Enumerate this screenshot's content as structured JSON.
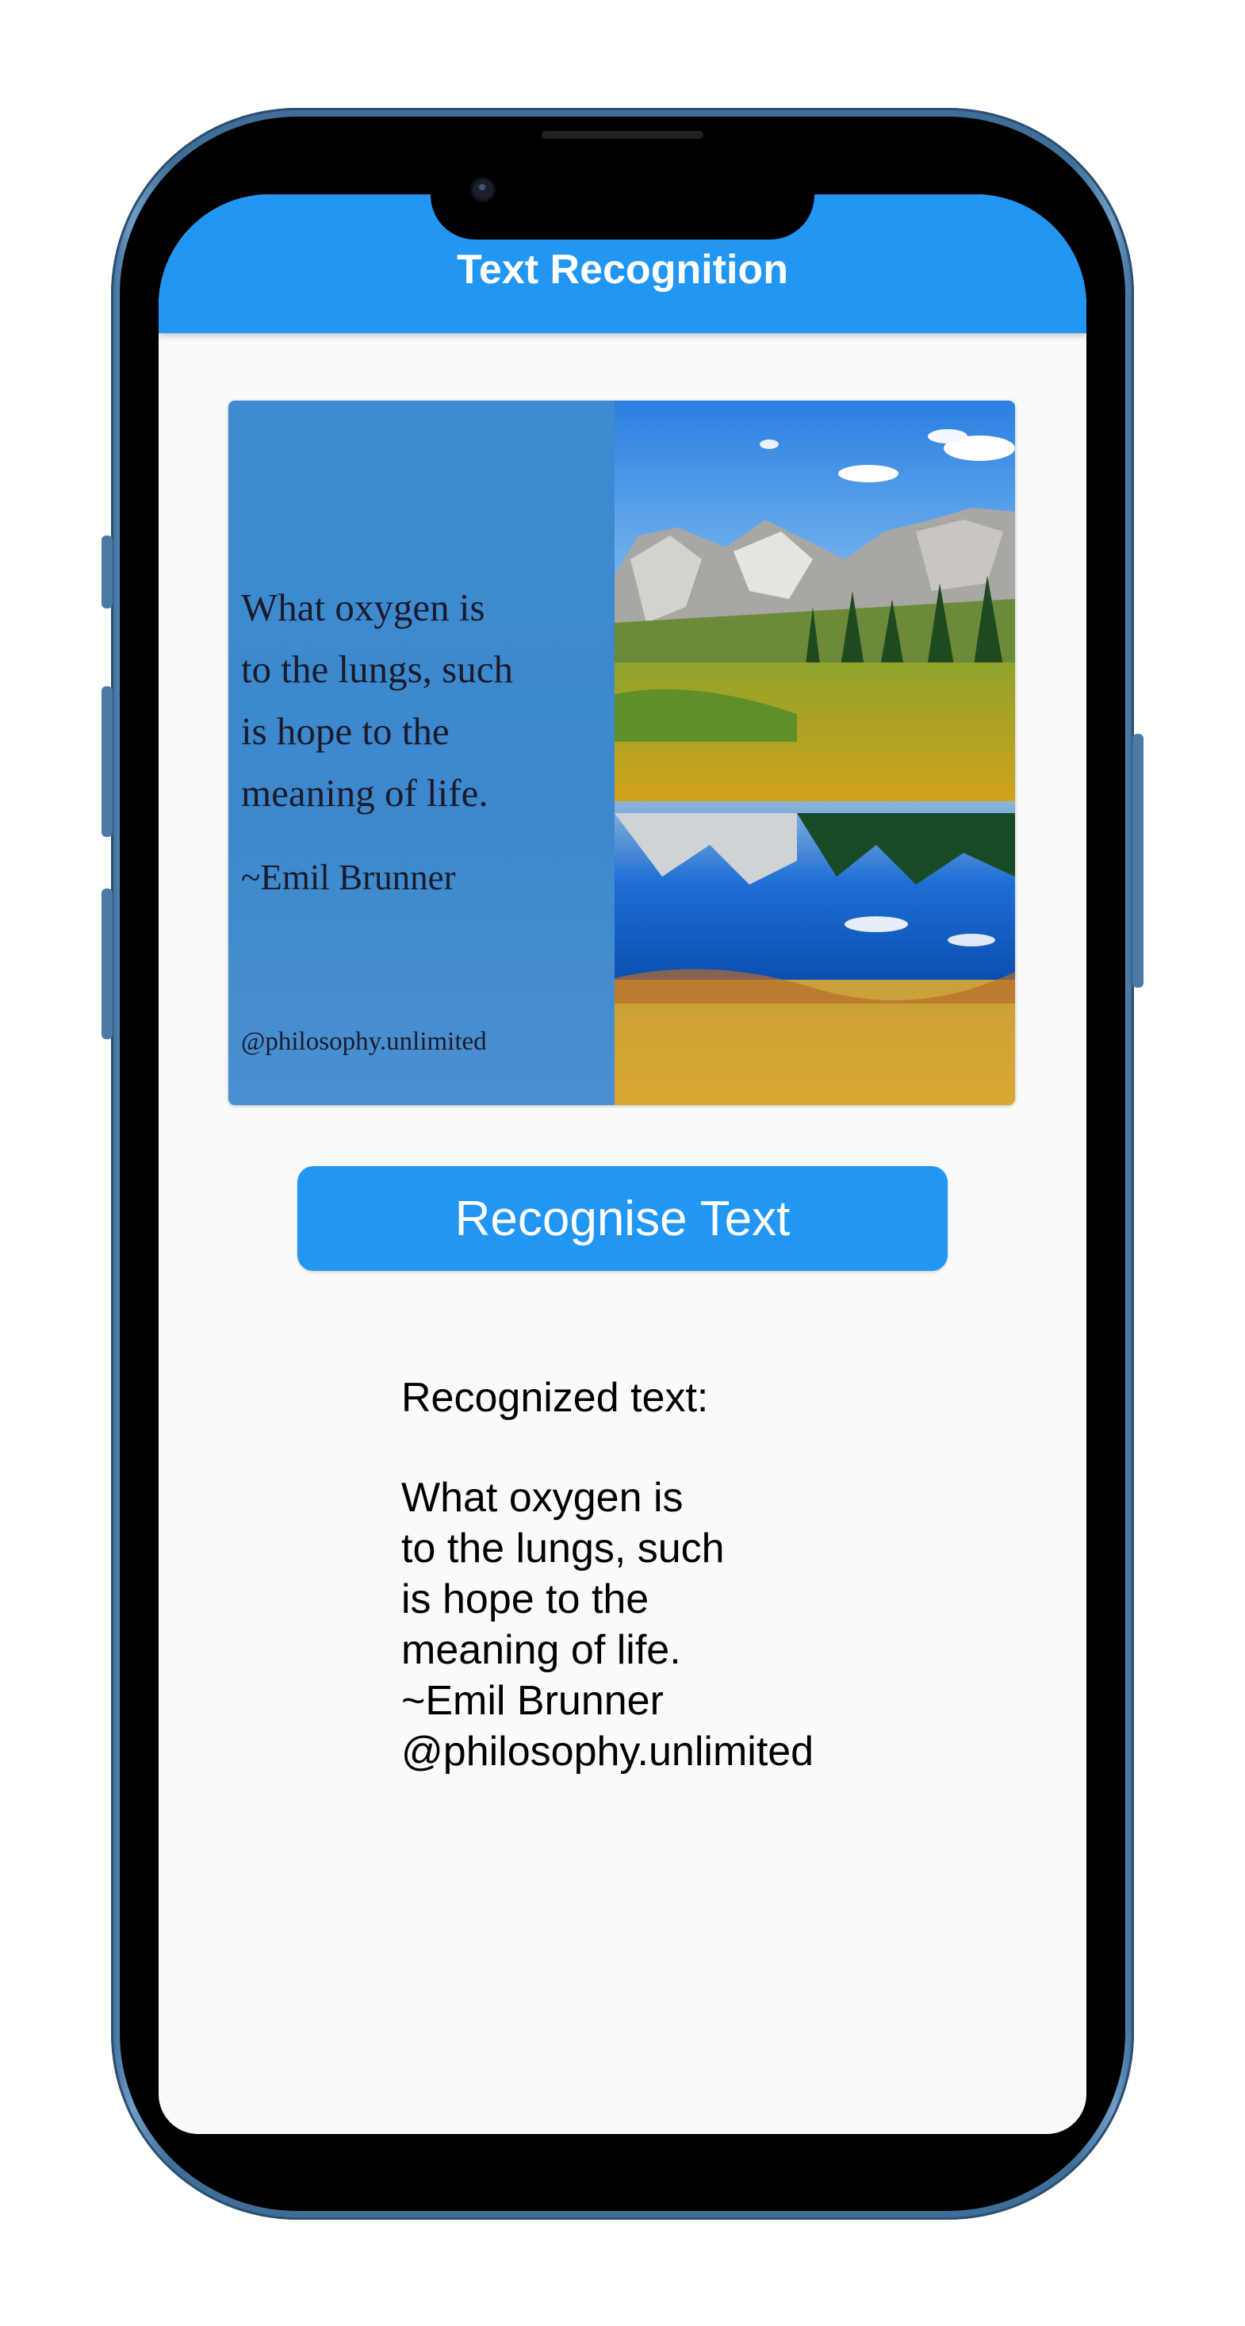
{
  "app": {
    "title": "Text Recognition",
    "accent_color": "#2196f3",
    "status_bar_time": ""
  },
  "image": {
    "quote_lines": [
      "What oxygen is",
      "to the lungs, such",
      "is hope to the",
      "meaning of life."
    ],
    "author": "~Emil Brunner",
    "handle": "@philosophy.unlimited"
  },
  "actions": {
    "recognise_label": "Recognise Text"
  },
  "result": {
    "label": "Recognized text:",
    "lines": [
      "What oxygen is",
      "to the lungs, such",
      "is hope to the",
      "meaning of life.",
      "~Emil Brunner",
      "@philosophy.unlimited"
    ]
  }
}
